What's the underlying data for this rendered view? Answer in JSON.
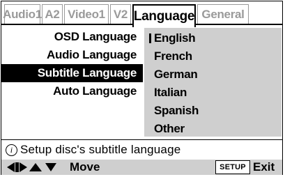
{
  "tabs": [
    {
      "label": "Audio1",
      "active": false
    },
    {
      "label": "A2",
      "active": false
    },
    {
      "label": "Video1",
      "active": false
    },
    {
      "label": "V2",
      "active": false
    },
    {
      "label": "Language",
      "active": true
    },
    {
      "label": "General",
      "active": false
    }
  ],
  "menu": {
    "items": [
      {
        "label": "OSD Language"
      },
      {
        "label": "Audio Language"
      },
      {
        "label": "Subtitle Language",
        "selected": true
      },
      {
        "label": "Auto Language"
      }
    ]
  },
  "options": {
    "items": [
      {
        "label": "English",
        "current": true
      },
      {
        "label": "French"
      },
      {
        "label": "German"
      },
      {
        "label": "Italian"
      },
      {
        "label": "Spanish"
      },
      {
        "label": "Other"
      }
    ]
  },
  "info": {
    "icon": "info-icon",
    "icon_glyph": "i",
    "text": "Setup disc's subtitle language"
  },
  "footer": {
    "move_label": "Move",
    "setup_label": "SETUP",
    "exit_label": "Exit"
  },
  "colors": {
    "panel_gray": "#cfcfcf",
    "inactive_tab": "#9a9a9a",
    "selected_bg": "#000000"
  }
}
